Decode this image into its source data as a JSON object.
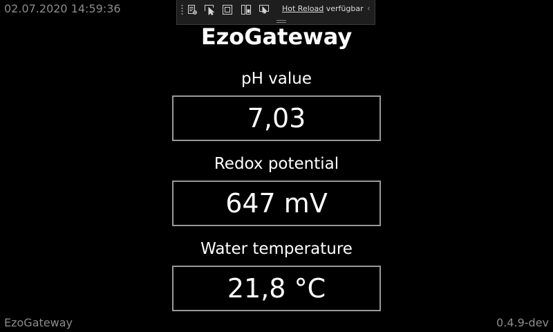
{
  "header": {
    "timestamp": "02.07.2020 14:59:36"
  },
  "dev_toolbar": {
    "icons": [
      "live-visual-tree-icon",
      "select-element-icon",
      "display-adorners-icon",
      "track-focus-icon",
      "preview-selection-icon"
    ],
    "hot_reload_link": "Hot Reload",
    "hot_reload_status": "verfügbar",
    "collapse_glyph": "‹"
  },
  "app": {
    "title": "EzoGateway"
  },
  "metrics": [
    {
      "label": "pH value",
      "value": "7,03"
    },
    {
      "label": "Redox potential",
      "value": "647 mV"
    },
    {
      "label": "Water temperature",
      "value": "21,8 °C"
    }
  ],
  "footer": {
    "app_name": "EzoGateway",
    "version": "0.4.9-dev"
  },
  "colors": {
    "background": "#000000",
    "text": "#ffffff",
    "muted_text": "#8c8c8c",
    "box_border": "#9a9a9a",
    "toolbar_bg": "#1e1e1e"
  }
}
